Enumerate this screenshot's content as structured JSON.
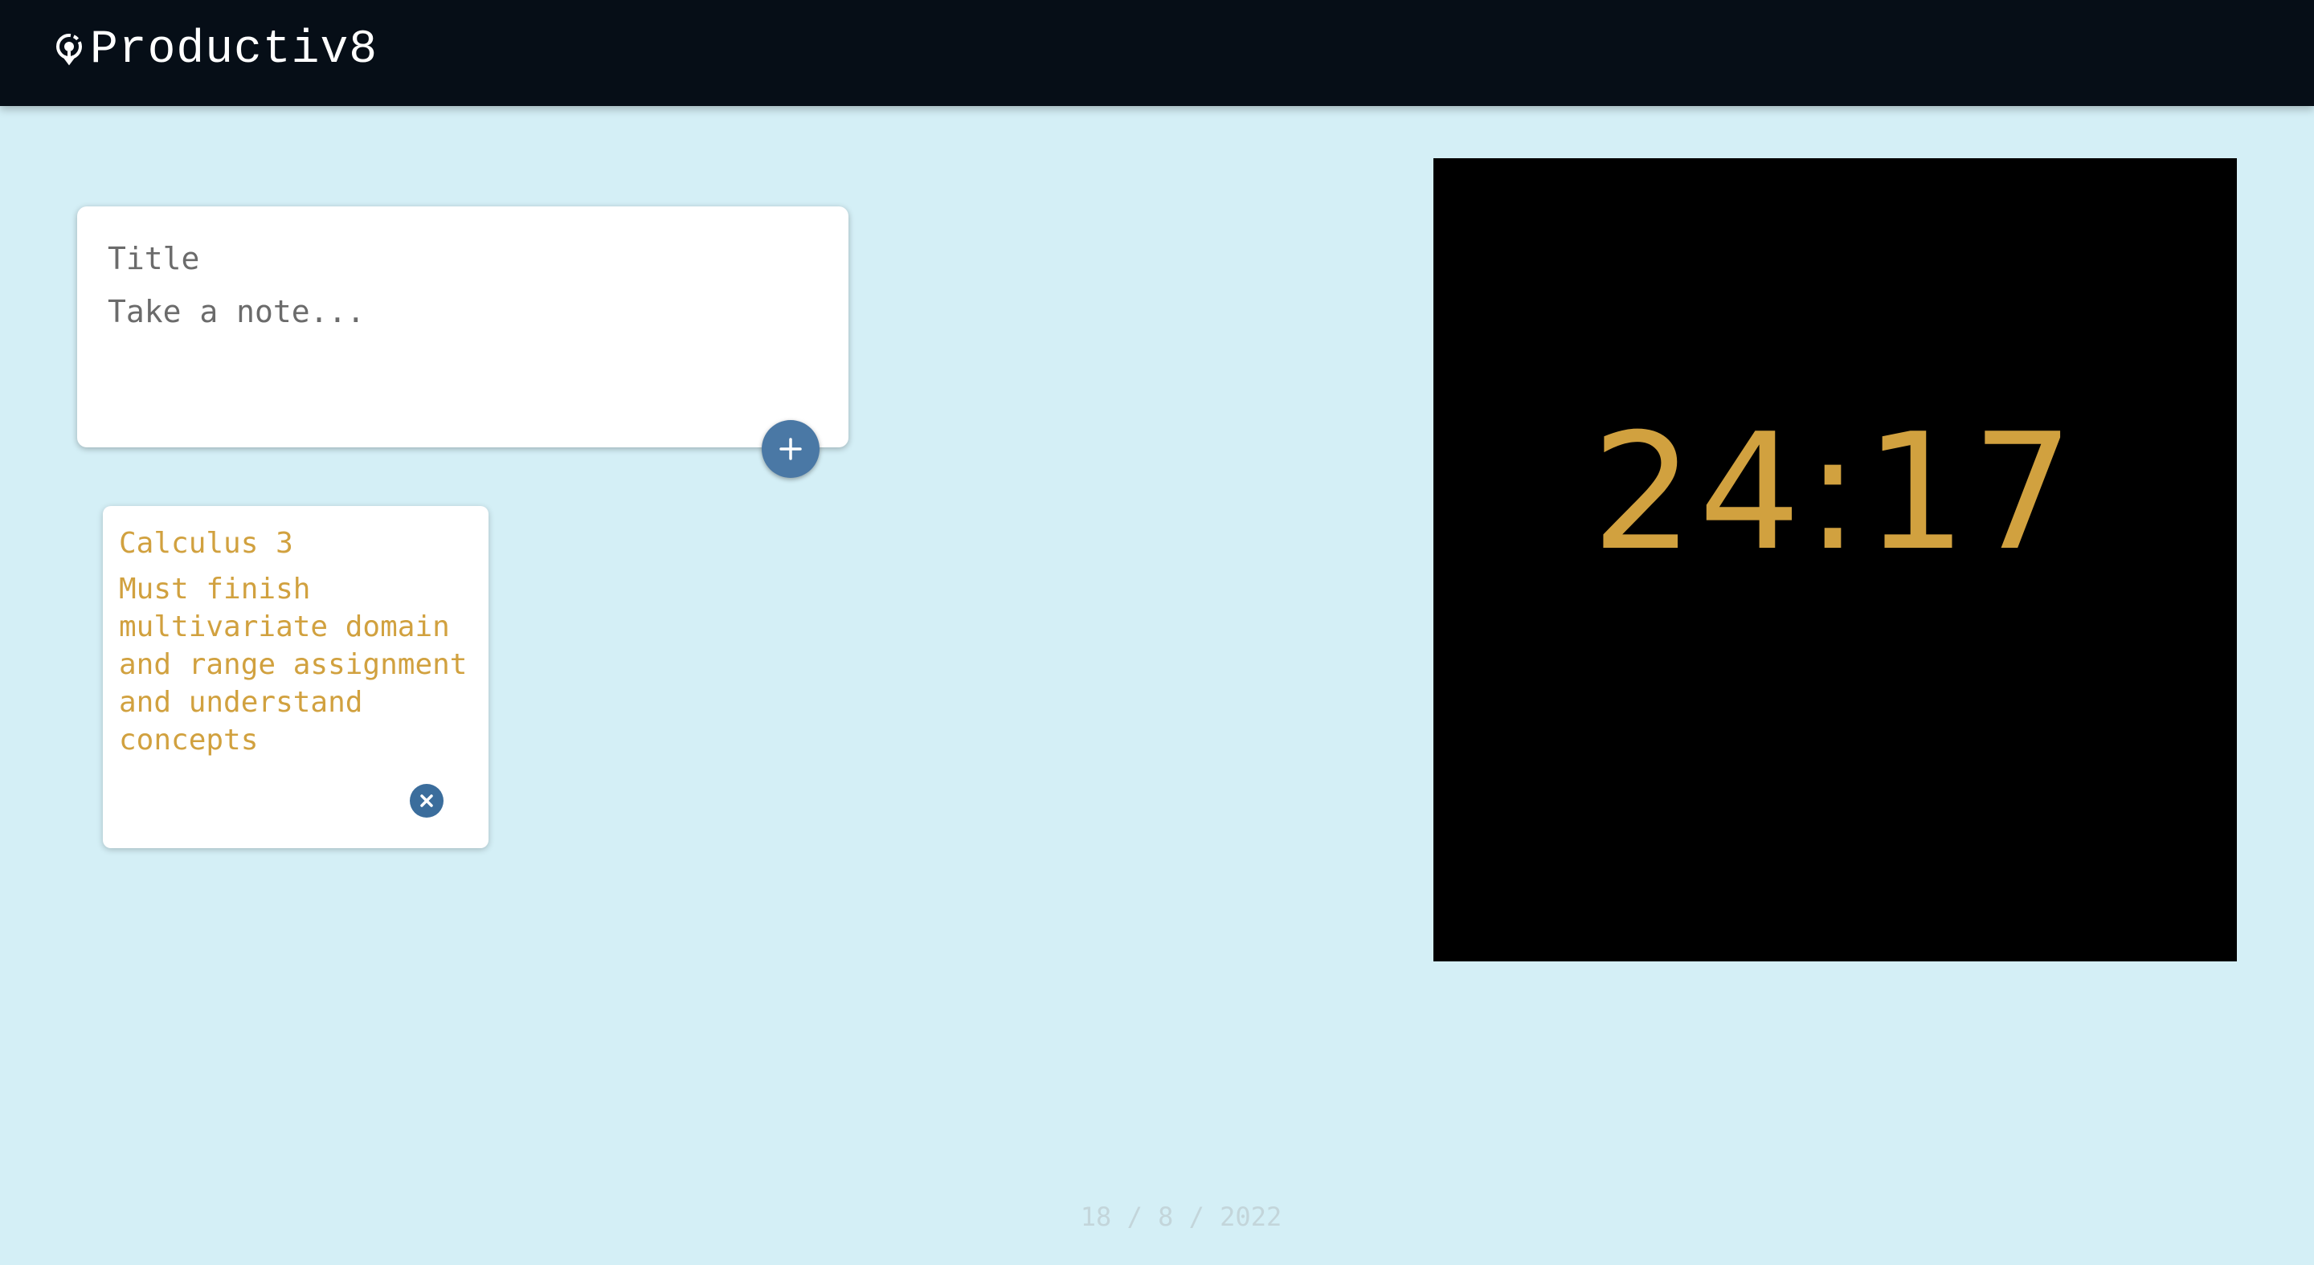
{
  "header": {
    "app_title": "Productiv8",
    "logo_icon": "refresh-cycle-icon",
    "background": "#060e17"
  },
  "composer": {
    "title_placeholder": "Title",
    "note_placeholder": "Take a note...",
    "add_icon": "plus-icon"
  },
  "notes": [
    {
      "title": "Calculus 3",
      "content": "Must finish multivariate domain and range assignment and understand concepts",
      "delete_icon": "close-circle-icon"
    }
  ],
  "timer": {
    "minutes": "24",
    "separator": ":",
    "seconds": "17"
  },
  "footer": {
    "date": "18 / 8 / 2022"
  },
  "colors": {
    "page_background": "#d4eff6",
    "accent_gold": "#d1a13f",
    "button_blue": "#4a78a5",
    "timer_background": "#000000"
  }
}
